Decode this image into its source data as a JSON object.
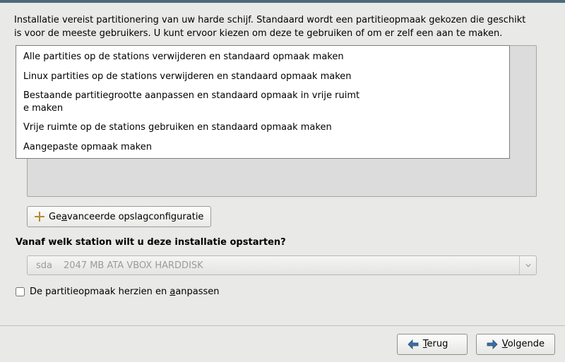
{
  "intro": {
    "line1": "Installatie vereist partitionering van uw harde schijf. Standaard wordt een partitieopmaak gekozen die geschikt",
    "line2": "is voor de meeste gebruikers. U kunt ervoor kiezen om deze te gebruiken of om er zelf een aan te maken."
  },
  "dropdown_options": [
    "Alle partities op de stations verwijderen en standaard opmaak maken",
    "Linux partities op de stations verwijderen en standaard opmaak maken",
    "Bestaande partitiegrootte aanpassen en standaard opmaak in vrije ruimt\ne maken",
    "Vrije ruimte op de stations gebruiken en standaard opmaak maken",
    "Aangepaste opmaak maken"
  ],
  "advanced_button": {
    "pre": "Ge",
    "access": "a",
    "post": "vanceerde opslagconfiguratie"
  },
  "boot_question": "Vanaf welk station wilt u deze installatie opstarten?",
  "drive": {
    "dev": "sda",
    "desc": "2047 MB ATA VBOX HARDDISK"
  },
  "review": {
    "pre": "De partitieopmaak herzien en ",
    "access": "a",
    "post": "anpassen",
    "checked": false
  },
  "buttons": {
    "back": {
      "access": "T",
      "rest": "erug"
    },
    "next": {
      "access": "V",
      "rest": "olgende"
    }
  }
}
